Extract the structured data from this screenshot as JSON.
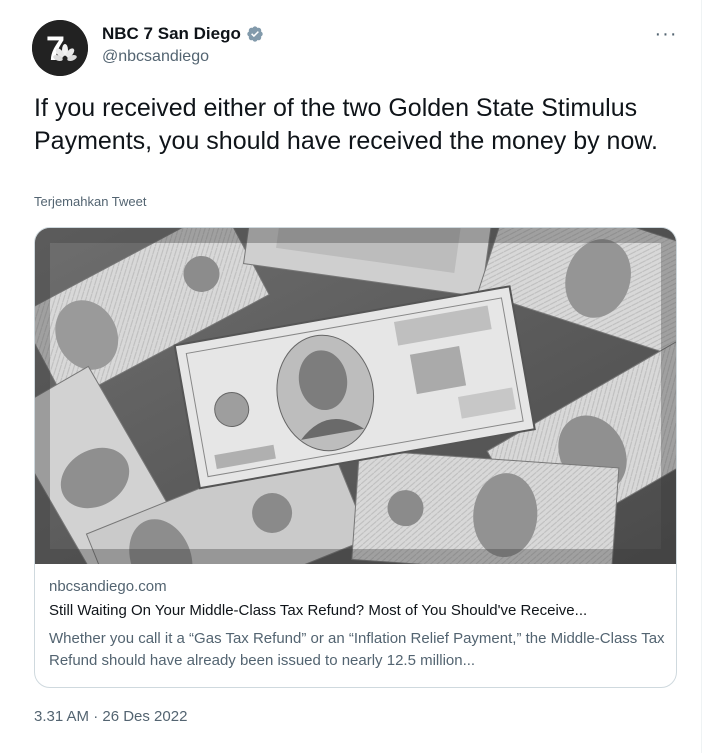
{
  "tweet": {
    "author": {
      "display_name": "NBC 7 San Diego",
      "handle": "@nbcsandiego",
      "avatar_text": "7",
      "verified": true
    },
    "more_icon": "more-horizontal-icon",
    "text": "If you received either of the two Golden State Stimulus Payments, you should have received the money by now.",
    "translate_label": "Terjemahkan Tweet",
    "card": {
      "image_alt": "Pile of hundred and twenty dollar bills",
      "domain": "nbcsandiego.com",
      "title": "Still Waiting On Your Middle-Class Tax Refund? Most of You Should've Receive...",
      "description": "Whether you call it a “Gas Tax Refund” or an “Inflation Relief Payment,” the Middle-Class Tax Refund should have already been issued to nearly 12.5 million..."
    },
    "timestamp": "3.31 AM · 26 Des 2022"
  },
  "colors": {
    "text_primary": "#0f1419",
    "text_secondary": "#536471",
    "border": "#cfd9de",
    "verified_badge": "#829aab"
  }
}
